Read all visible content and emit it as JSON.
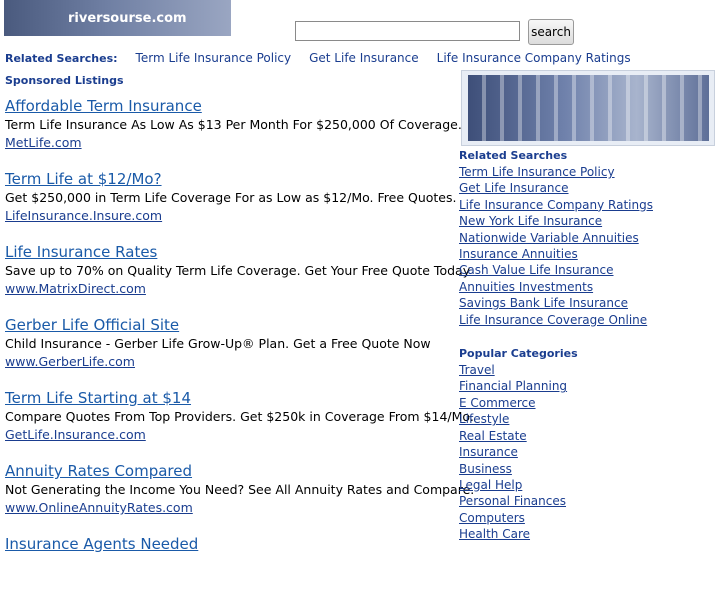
{
  "logo": {
    "text": "riversourse.com"
  },
  "search": {
    "value": "",
    "button_label": "search"
  },
  "related_top": {
    "label": "Related Searches:",
    "links": [
      "Term Life Insurance Policy",
      "Get Life Insurance",
      "Life Insurance Company Ratings"
    ]
  },
  "sponsored_label": "Sponsored Listings",
  "listings": [
    {
      "title": "Affordable Term Insurance",
      "desc": "Term Life Insurance As Low As $13 Per Month For $250,000 Of Coverage.",
      "url": "MetLife.com"
    },
    {
      "title": "Term Life at $12/Mo?",
      "desc": "Get $250,000 in Term Life Coverage For as Low as $12/Mo. Free Quotes.",
      "url": "LifeInsurance.Insure.com"
    },
    {
      "title": "Life Insurance Rates",
      "desc": "Save up to 70% on Quality Term Life Coverage. Get Your Free Quote Today",
      "url": "www.MatrixDirect.com"
    },
    {
      "title": "Gerber Life Official Site",
      "desc": "Child Insurance - Gerber Life Grow-Up® Plan. Get a Free Quote Now",
      "url": "www.GerberLife.com"
    },
    {
      "title": "Term Life Starting at $14",
      "desc": "Compare Quotes From Top Providers. Get $250k in Coverage From $14/Mo.",
      "url": "GetLife.Insurance.com"
    },
    {
      "title": "Annuity Rates Compared",
      "desc": "Not Generating the Income You Need? See All Annuity Rates and Compare.",
      "url": "www.OnlineAnnuityRates.com"
    },
    {
      "title": "Insurance Agents Needed",
      "desc": "",
      "url": ""
    }
  ],
  "right_related": {
    "heading": "Related Searches",
    "links": [
      "Term Life Insurance Policy",
      "Get Life Insurance",
      "Life Insurance Company Ratings",
      "New York Life Insurance",
      "Nationwide Variable Annuities",
      "Insurance Annuities",
      "Cash Value Life Insurance",
      "Annuities Investments",
      "Savings Bank Life Insurance",
      "Life Insurance Coverage Online"
    ]
  },
  "popular": {
    "heading": "Popular Categories",
    "links": [
      "Travel",
      "Financial Planning",
      "E Commerce",
      "Lifestyle",
      "Real Estate",
      "Insurance",
      "Business",
      "Legal Help",
      "Personal Finances",
      "Computers",
      "Health Care"
    ]
  }
}
